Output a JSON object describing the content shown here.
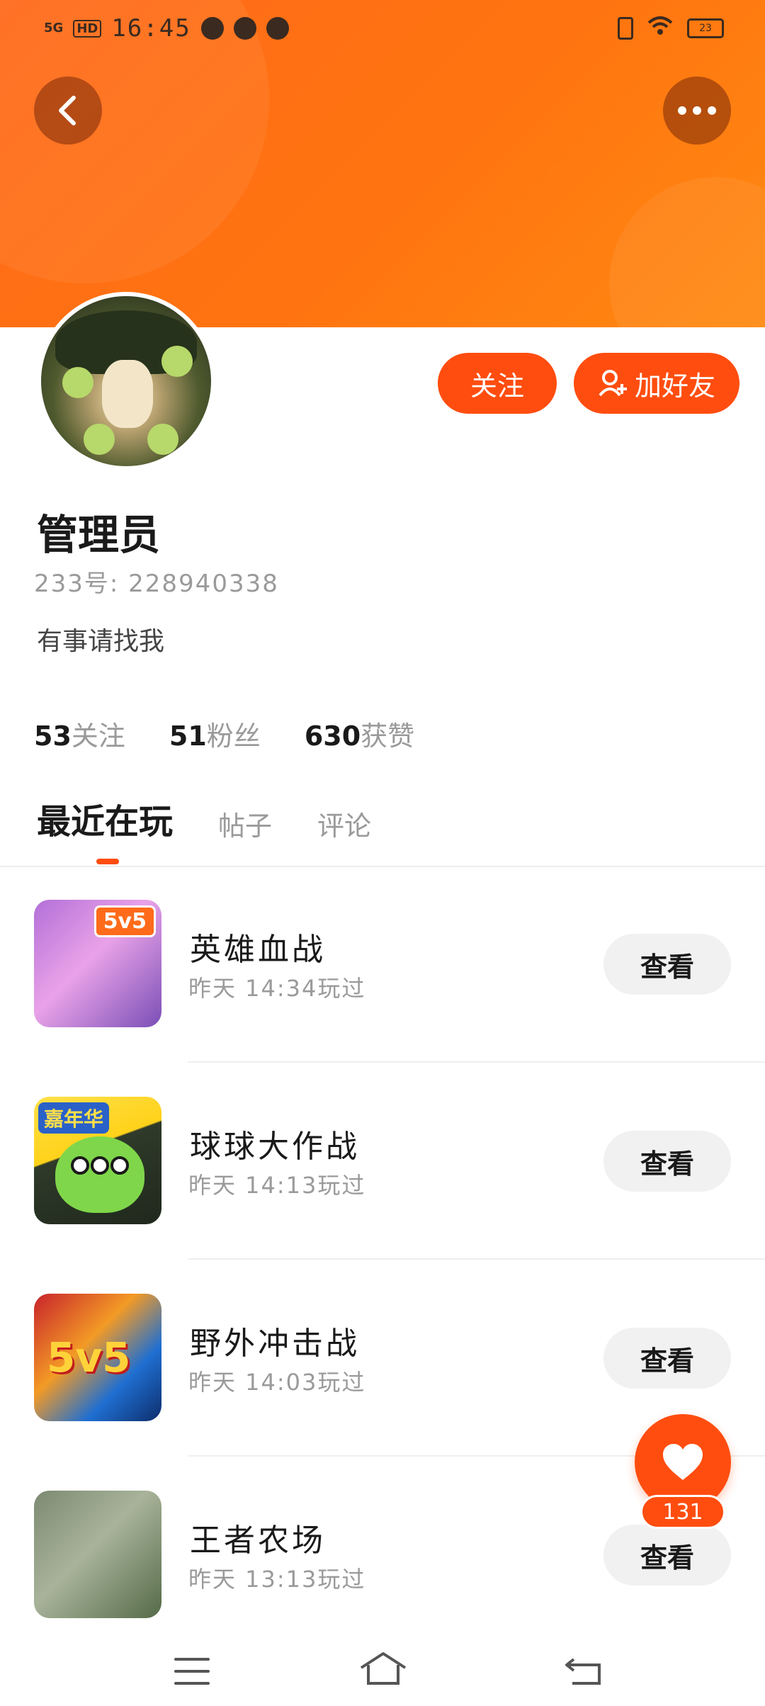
{
  "status_bar": {
    "network": "5G",
    "hd": "HD",
    "time": "16:45",
    "battery": "23"
  },
  "profile": {
    "name": "管理员",
    "uid": "233号: 228940338",
    "bio": "有事请找我",
    "follow_label": "关注",
    "add_friend_label": "加好友"
  },
  "stats": [
    {
      "value": "53",
      "label": "关注"
    },
    {
      "value": "51",
      "label": "粉丝"
    },
    {
      "value": "630",
      "label": "获赞"
    }
  ],
  "tabs": [
    {
      "label": "最近在玩",
      "active": true
    },
    {
      "label": "帖子",
      "active": false
    },
    {
      "label": "评论",
      "active": false
    }
  ],
  "games": [
    {
      "name": "英雄血战",
      "last_played": "昨天 14:34玩过",
      "action": "查看",
      "badge": "5v5"
    },
    {
      "name": "球球大作战",
      "last_played": "昨天 14:13玩过",
      "action": "查看",
      "badge": "嘉年华"
    },
    {
      "name": "野外冲击战",
      "last_played": "昨天 14:03玩过",
      "action": "查看",
      "badge": "5v5"
    },
    {
      "name": "王者农场",
      "last_played": "昨天 13:13玩过",
      "action": "查看"
    }
  ],
  "like_fab": {
    "count": "131",
    "icon": "heart-icon"
  },
  "colors": {
    "banner": "#ff7410",
    "accent": "#ff4d0f",
    "view_button_bg": "#f1f1f1"
  }
}
